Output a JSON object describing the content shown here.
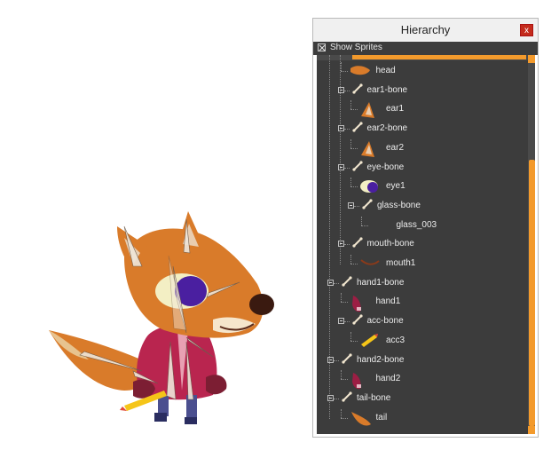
{
  "window": {
    "title": "Hierarchy",
    "close_label": "x"
  },
  "toolbar": {
    "show_sprites_label": "Show Sprites",
    "show_sprites_checked": true
  },
  "scrollbar": {
    "position": 0.28
  },
  "accent_color": "#f39a2c",
  "tree": {
    "rows": [
      {
        "label": "head",
        "kind": "sprite",
        "icon": "head-sprite-icon",
        "depth": 1
      },
      {
        "label": "ear1-bone",
        "kind": "bone",
        "icon": "bone-icon",
        "depth": 1,
        "expanded": true
      },
      {
        "label": "ear1",
        "kind": "sprite",
        "icon": "ear-sprite-icon",
        "depth": 2
      },
      {
        "label": "ear2-bone",
        "kind": "bone",
        "icon": "bone-icon",
        "depth": 1,
        "expanded": true
      },
      {
        "label": "ear2",
        "kind": "sprite",
        "icon": "ear-sprite-icon",
        "depth": 2
      },
      {
        "label": "eye-bone",
        "kind": "bone",
        "icon": "bone-icon",
        "depth": 1,
        "expanded": true
      },
      {
        "label": "eye1",
        "kind": "sprite",
        "icon": "eye-sprite-icon",
        "depth": 2
      },
      {
        "label": "glass-bone",
        "kind": "bone",
        "icon": "bone-icon",
        "depth": 2,
        "expanded": true
      },
      {
        "label": "glass_003",
        "kind": "sprite",
        "icon": "",
        "depth": 3
      },
      {
        "label": "mouth-bone",
        "kind": "bone",
        "icon": "bone-icon",
        "depth": 1,
        "expanded": true
      },
      {
        "label": "mouth1",
        "kind": "sprite",
        "icon": "mouth-sprite-icon",
        "depth": 2
      },
      {
        "label": "hand1-bone",
        "kind": "bone",
        "icon": "bone-icon",
        "depth": 0,
        "expanded": true
      },
      {
        "label": "hand1",
        "kind": "sprite",
        "icon": "hand-sprite-icon",
        "depth": 1
      },
      {
        "label": "acc-bone",
        "kind": "bone",
        "icon": "bone-icon",
        "depth": 1,
        "expanded": true
      },
      {
        "label": "acc3",
        "kind": "sprite",
        "icon": "pencil-sprite-icon",
        "depth": 2
      },
      {
        "label": "hand2-bone",
        "kind": "bone",
        "icon": "bone-icon",
        "depth": 0,
        "expanded": true
      },
      {
        "label": "hand2",
        "kind": "sprite",
        "icon": "hand-sprite-icon",
        "depth": 1
      },
      {
        "label": "tail-bone",
        "kind": "bone",
        "icon": "bone-icon",
        "depth": 0,
        "expanded": true
      },
      {
        "label": "tail",
        "kind": "sprite",
        "icon": "tail-sprite-icon",
        "depth": 1
      }
    ]
  }
}
